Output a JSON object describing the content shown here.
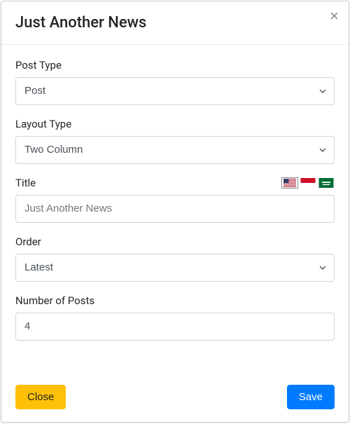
{
  "header": {
    "title": "Just Another News",
    "close_glyph": "×"
  },
  "form": {
    "post_type": {
      "label": "Post Type",
      "value": "Post"
    },
    "layout_type": {
      "label": "Layout Type",
      "value": "Two Column"
    },
    "title_field": {
      "label": "Title",
      "placeholder": "Just Another News",
      "value": ""
    },
    "order": {
      "label": "Order",
      "value": "Latest"
    },
    "num_posts": {
      "label": "Number of Posts",
      "value": "4"
    }
  },
  "flags": {
    "us": "us-flag",
    "id": "indonesia-flag",
    "sa": "saudi-flag"
  },
  "footer": {
    "close_label": "Close",
    "save_label": "Save"
  }
}
